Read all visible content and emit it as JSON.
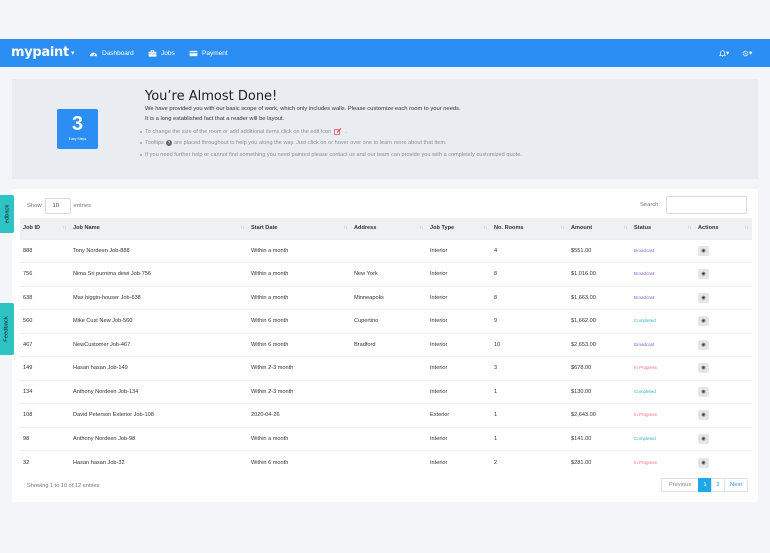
{
  "header": {
    "logo": "mypaint",
    "nav": [
      {
        "label": "Dashboard",
        "icon": "dashboard-icon"
      },
      {
        "label": "Jobs",
        "icon": "briefcase-icon"
      },
      {
        "label": "Payment",
        "icon": "payment-icon"
      }
    ],
    "right_icons": [
      "bell-icon",
      "gear-icon"
    ]
  },
  "banner": {
    "steps_number": "3",
    "steps_label": "Easy Steps",
    "title": "You’re Almost Done!",
    "line1": "We have provided you with our basic scope of work, which only includes walls. Please customize each room to your needs.",
    "line2": "It is a long established fact that a reader will be layout.",
    "bullet1": "To change the size of the room or add additional items click on the edit icon",
    "bullet1_end": ".",
    "bullet2_pre": "Tooltips",
    "bullet2_post": "are placed throughout to help you along the way. Just click on or hover over one to learn more about that item.",
    "bullet3": "If you need further help or cannot find something you need painted please contact us and our team can provide you with a completely customized quote."
  },
  "table_controls": {
    "show_label": "Show",
    "show_value": "10",
    "entries_label": "entries",
    "search_label": "Search:"
  },
  "table": {
    "columns": [
      "Job ID",
      "Job Name",
      "Start Date",
      "Address",
      "Job Type",
      "No. Rooms",
      "Amount",
      "Status",
      "Actions"
    ],
    "rows": [
      {
        "id": "888",
        "name": "Tony Nordeen Job-888",
        "start": "Within a month",
        "address": "",
        "type": "Interior",
        "rooms": "4",
        "amount": "$551.00",
        "status": "Broadcast"
      },
      {
        "id": "756",
        "name": "Nima Sri purnima dewi Job-756",
        "start": "Within a month",
        "address": "New York",
        "type": "Interior",
        "rooms": "8",
        "amount": "$1,016.00",
        "status": "Broadcast"
      },
      {
        "id": "638",
        "name": "Max higgin-houser Job-638",
        "start": "Within a month",
        "address": "Minneapolis",
        "type": "Interior",
        "rooms": "8",
        "amount": "$1,663.00",
        "status": "Broadcast"
      },
      {
        "id": "560",
        "name": "Mike Cust New Job-560",
        "start": "Within 6 month",
        "address": "Cupertino",
        "type": "Interior",
        "rooms": "9",
        "amount": "$1,662.00",
        "status": "Completed"
      },
      {
        "id": "467",
        "name": "NewCustomer Job-467",
        "start": "Within 6 month",
        "address": "Bradford",
        "type": "Interior",
        "rooms": "10",
        "amount": "$2,653.00",
        "status": "Broadcast"
      },
      {
        "id": "149",
        "name": "Hasan hasan Job-149",
        "start": "Within 2-3 month",
        "address": "",
        "type": "Interior",
        "rooms": "3",
        "amount": "$678.00",
        "status": "In Progress"
      },
      {
        "id": "134",
        "name": "Anthony Nordeen Job-134",
        "start": "Within 2-3 month",
        "address": "",
        "type": "Interior",
        "rooms": "1",
        "amount": "$130.00",
        "status": "Completed"
      },
      {
        "id": "108",
        "name": "David Peterson Exterior Job-108",
        "start": "2020-04-26",
        "address": "",
        "type": "Exterior",
        "rooms": "1",
        "amount": "$2,643.00",
        "status": "In Progress"
      },
      {
        "id": "98",
        "name": "Anthony Nordeen Job-98",
        "start": "Within a month",
        "address": "",
        "type": "Interior",
        "rooms": "1",
        "amount": "$141.00",
        "status": "Completed"
      },
      {
        "id": "32",
        "name": "Hasan hasan Job-32",
        "start": "Within 6 month",
        "address": "",
        "type": "Interior",
        "rooms": "2",
        "amount": "$281.00",
        "status": "In Progress"
      }
    ]
  },
  "footer": {
    "info": "Showing 1 to 10 of 12 entries",
    "prev": "Previous",
    "pages": [
      "1",
      "2"
    ],
    "next": "Next"
  },
  "feedback": {
    "tab1": "edback",
    "tab2": "Feedback"
  },
  "colors": {
    "primary": "#2b8ef5",
    "broadcast": "#8a62c8",
    "completed": "#33b0c4",
    "in_progress": "#ef6b7b",
    "feedback_tab": "#2ec4c4"
  }
}
